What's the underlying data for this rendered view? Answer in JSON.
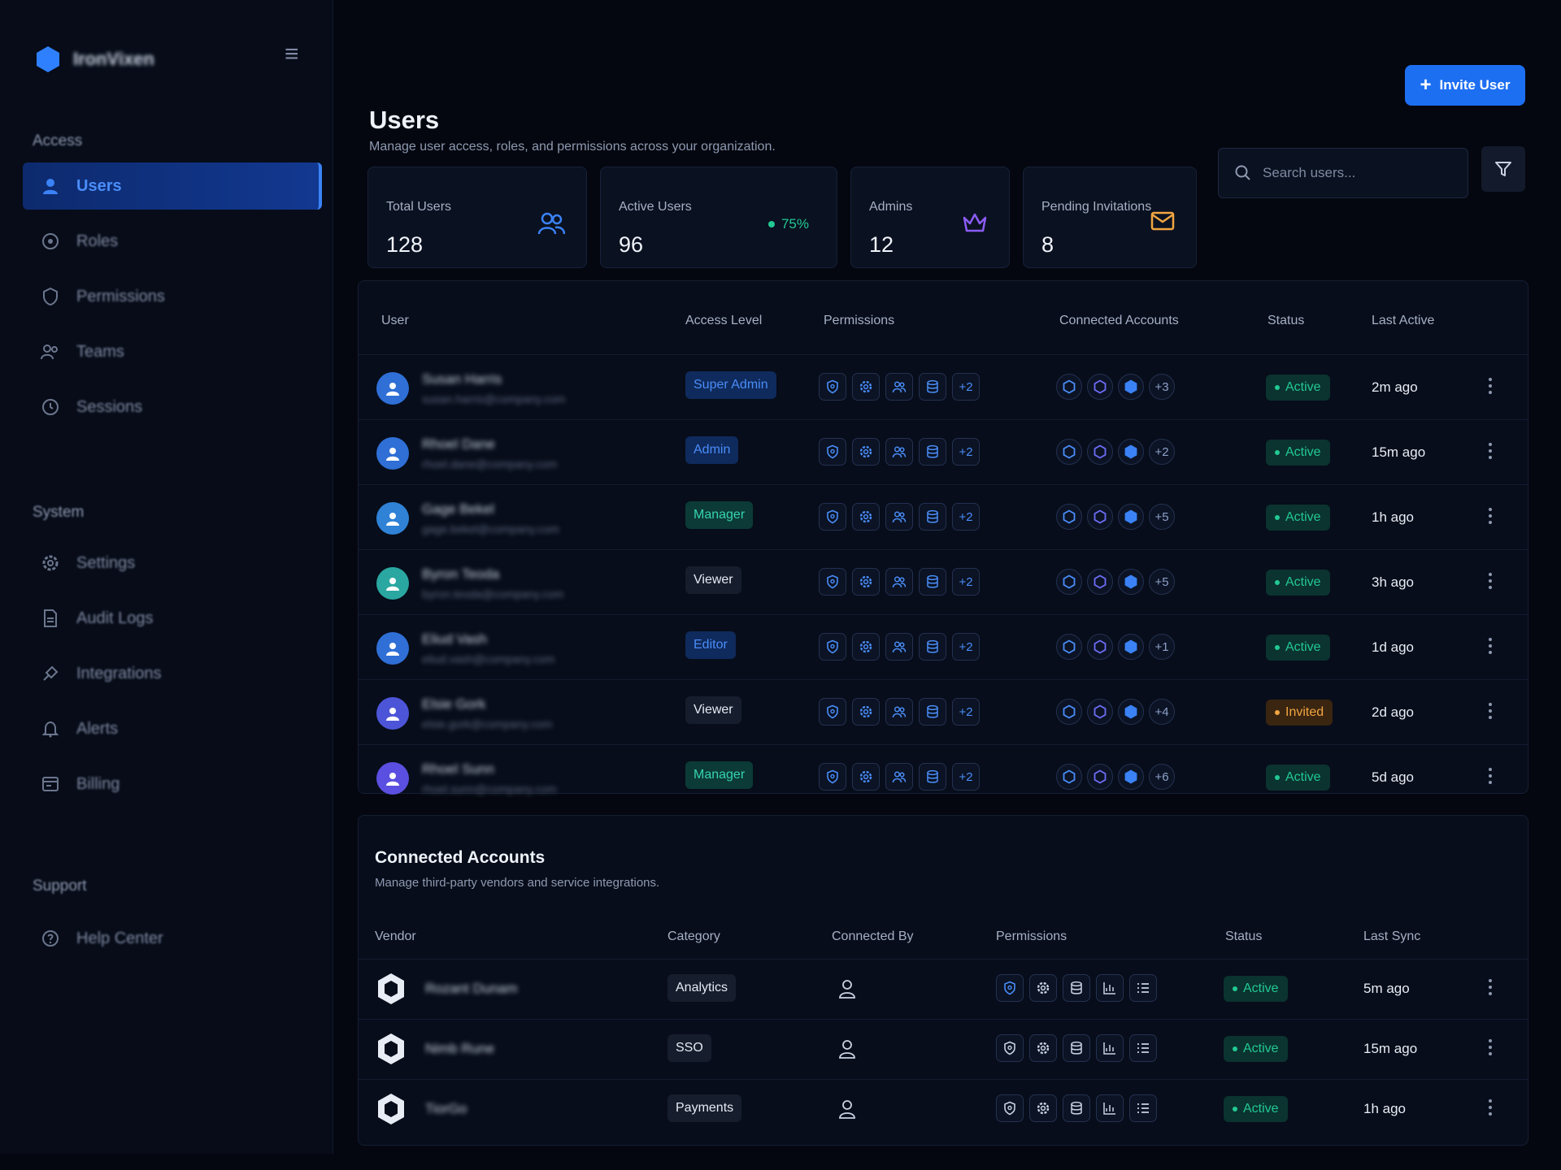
{
  "sidebar": {
    "brand_name": "IronVixen",
    "sections": [
      {
        "title": "Access",
        "items": [
          "Users",
          "Roles",
          "Permissions",
          "Teams",
          "Sessions"
        ]
      },
      {
        "title": "System",
        "items": [
          "Settings",
          "Audit Logs",
          "Integrations",
          "Alerts",
          "Billing"
        ]
      },
      {
        "title": "Support",
        "items": [
          "Help Center"
        ]
      }
    ],
    "active_item": "Users"
  },
  "header": {
    "title": "Users",
    "subtitle": "Manage user access, roles, and permissions across your organization.",
    "invite_label": "Invite User"
  },
  "stats": [
    {
      "label": "Total Users",
      "value": "128",
      "icon": "users-icon"
    },
    {
      "label": "Active Users",
      "value": "96",
      "percent": "75%"
    },
    {
      "label": "Admins",
      "value": "12",
      "icon": "crown-icon"
    },
    {
      "label": "Pending Invitations",
      "value": "8",
      "icon": "mail-icon"
    }
  ],
  "search": {
    "placeholder": "Search users..."
  },
  "users_table": {
    "columns": [
      "User",
      "Access Level",
      "Permissions",
      "Connected Accounts",
      "Status",
      "Last Active"
    ],
    "rows": [
      {
        "name": "Susan Harris",
        "email": "susan.harris@company.com",
        "access": "Super Admin",
        "perm_more": "+2",
        "acc_more": "+3",
        "status": "Active",
        "last_active": "2m ago",
        "avatar_color": "#2f6fd6"
      },
      {
        "name": "Rhoel Dane",
        "email": "rhoel.dane@company.com",
        "access": "Admin",
        "perm_more": "+2",
        "acc_more": "+2",
        "status": "Active",
        "last_active": "15m ago",
        "avatar_color": "#2f6fd6"
      },
      {
        "name": "Gage Bekel",
        "email": "gage.bekel@company.com",
        "access": "Manager",
        "perm_more": "+2",
        "acc_more": "+5",
        "status": "Active",
        "last_active": "1h ago",
        "avatar_color": "#2f82d6"
      },
      {
        "name": "Byron Teoda",
        "email": "byron.teoda@company.com",
        "access": "Viewer",
        "perm_more": "+2",
        "acc_more": "+5",
        "status": "Active",
        "last_active": "3h ago",
        "avatar_color": "#2aa7a0"
      },
      {
        "name": "Eliud Vash",
        "email": "eliud.vash@company.com",
        "access": "Editor",
        "perm_more": "+2",
        "acc_more": "+1",
        "status": "Active",
        "last_active": "1d ago",
        "avatar_color": "#2f6fd6"
      },
      {
        "name": "Elsie Gork",
        "email": "elsie.gork@company.com",
        "access": "Viewer",
        "perm_more": "+2",
        "acc_more": "+4",
        "status": "Invited",
        "last_active": "2d ago",
        "avatar_color": "#4c55d8"
      },
      {
        "name": "Rhoel Sunn",
        "email": "rhoel.sunn@company.com",
        "access": "Manager",
        "perm_more": "+2",
        "acc_more": "+6",
        "status": "Active",
        "last_active": "5d ago",
        "avatar_color": "#5a4fe0"
      }
    ]
  },
  "connected_accounts": {
    "title": "Connected Accounts",
    "subtitle": "Manage third-party vendors and service integrations.",
    "columns": [
      "Vendor",
      "Category",
      "Connected By",
      "Permissions",
      "Status",
      "Last Sync"
    ],
    "rows": [
      {
        "vendor": "Rozant Dunam",
        "category": "Analytics",
        "status": "Active",
        "last_sync": "5m ago"
      },
      {
        "vendor": "Nimb Rune",
        "category": "SSO",
        "status": "Active",
        "last_sync": "15m ago"
      },
      {
        "vendor": "TiorGo",
        "category": "Payments",
        "status": "Active",
        "last_sync": "1h ago"
      }
    ]
  },
  "colors": {
    "accent": "#1d6ff2",
    "active": "#22c993",
    "invited": "#f2a541",
    "background": "#04070f"
  }
}
